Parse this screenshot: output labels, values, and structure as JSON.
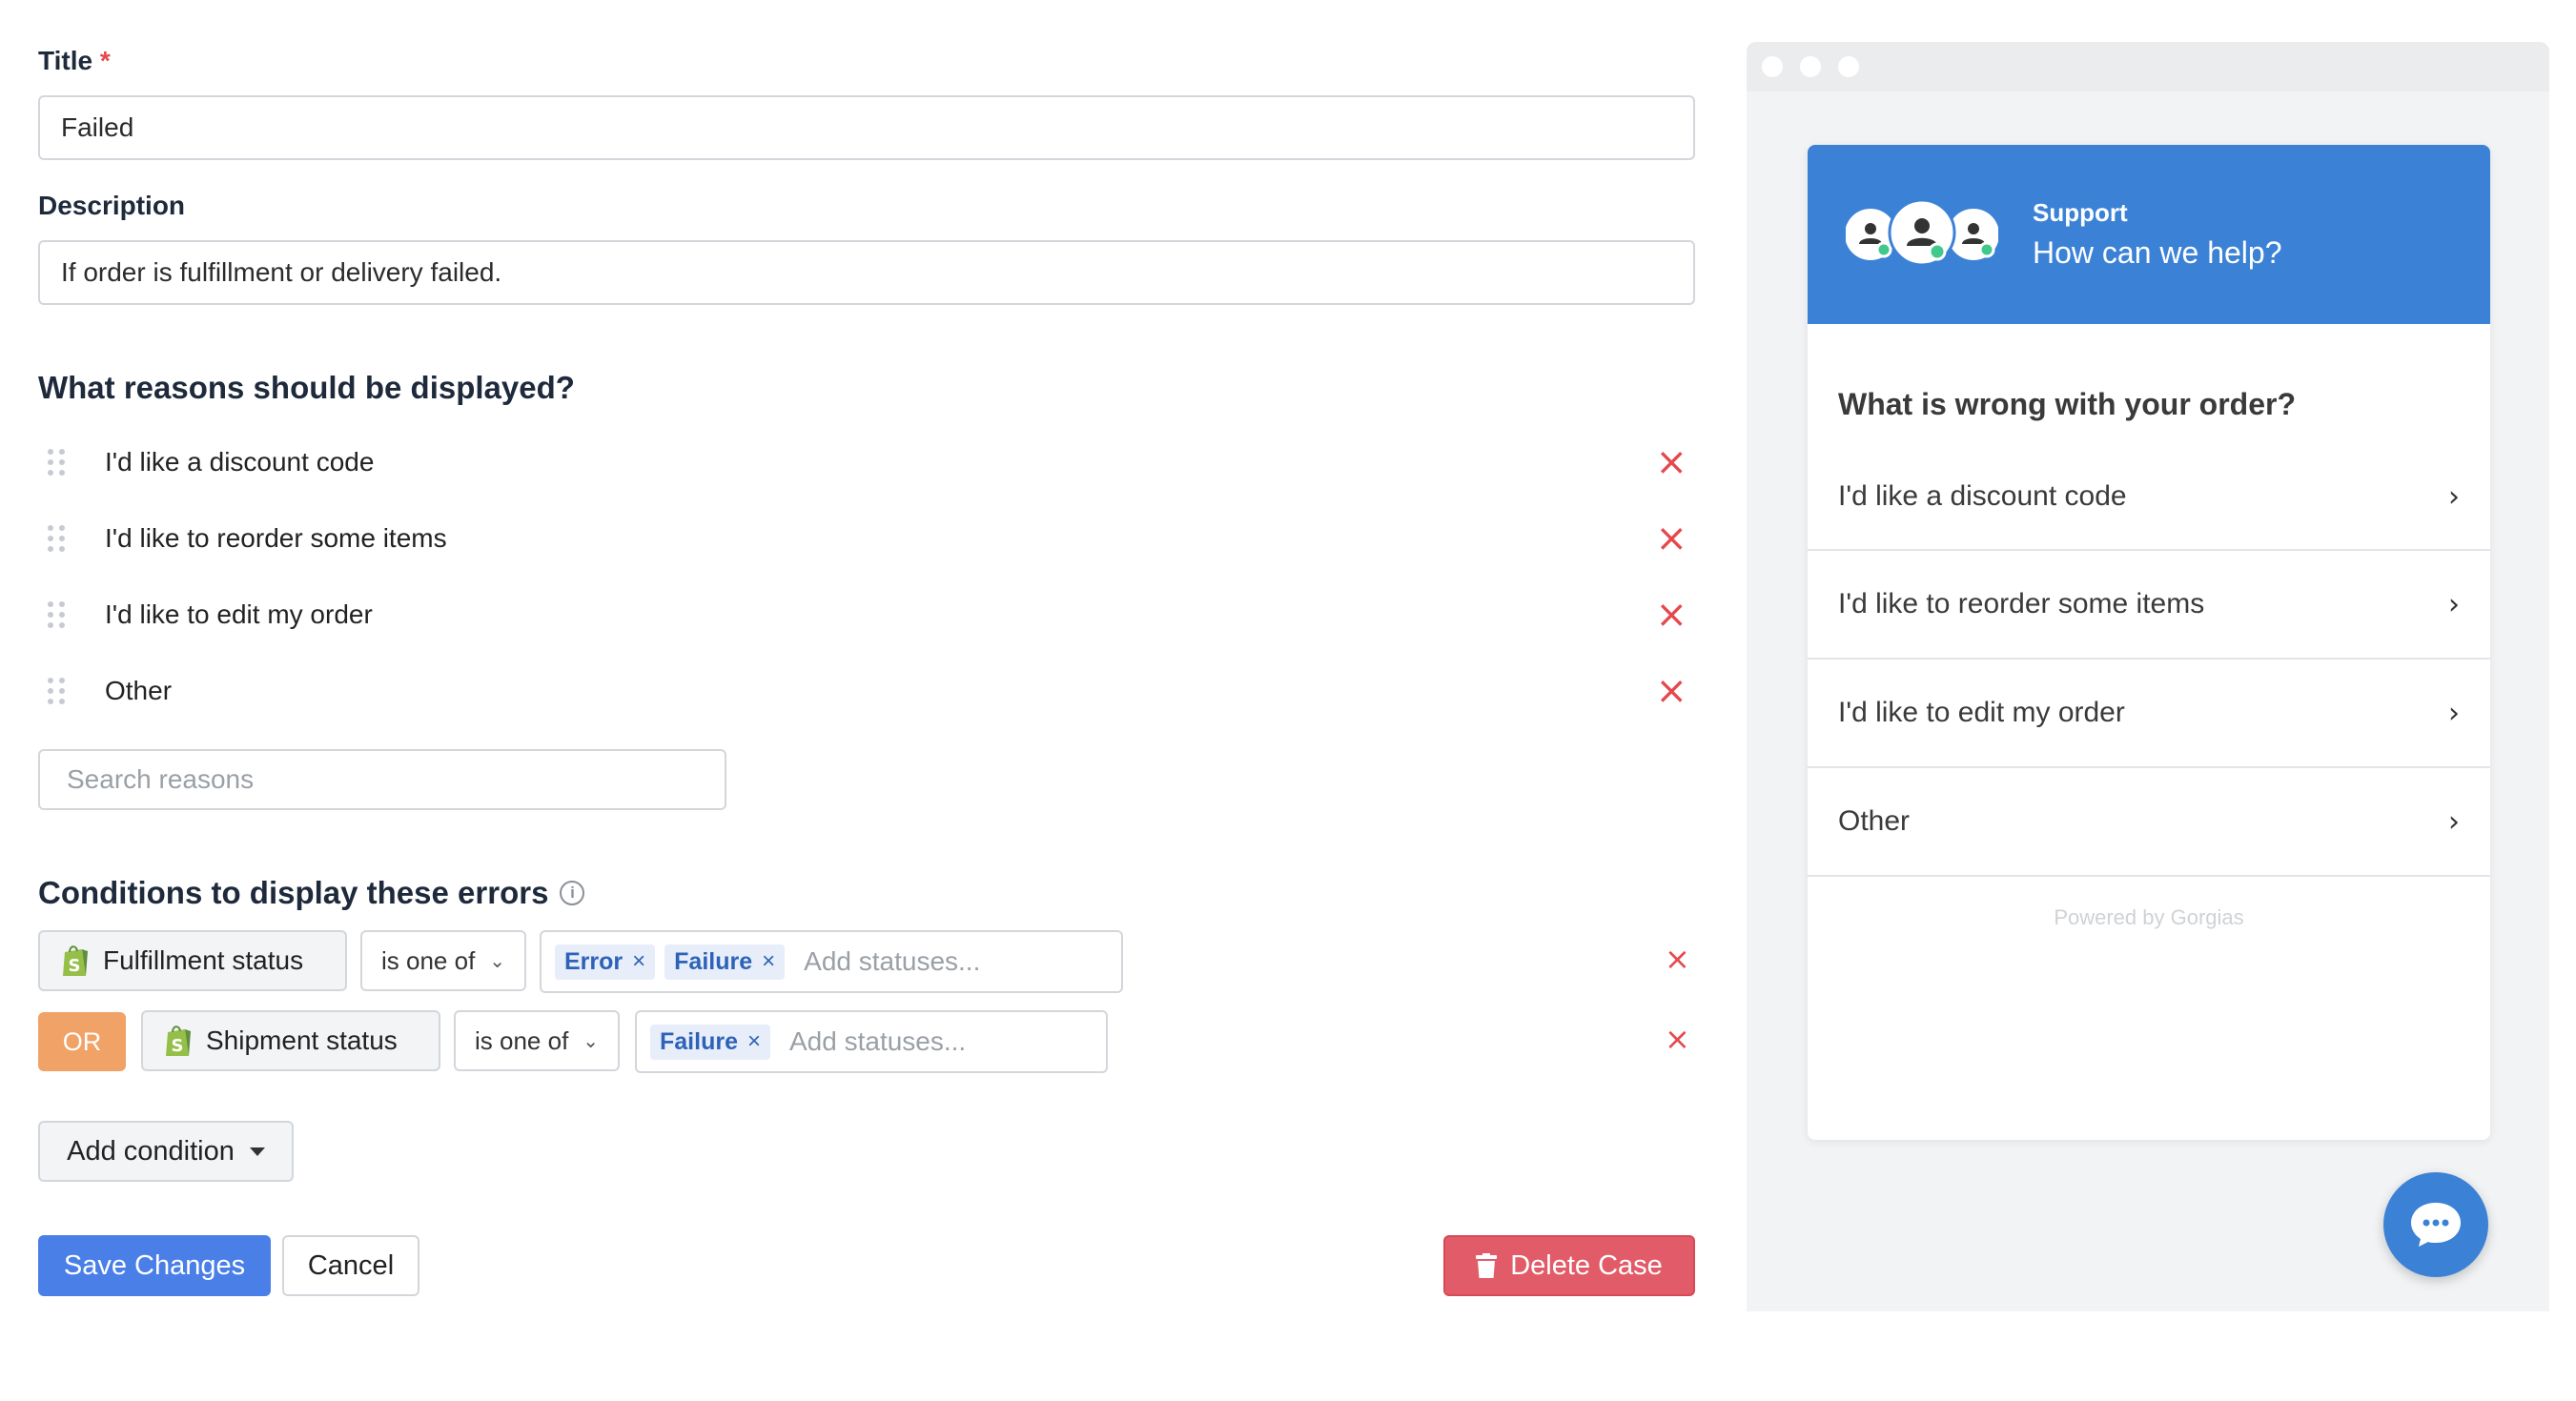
{
  "form": {
    "title_label": "Title",
    "required_mark": "*",
    "title_value": "Failed",
    "description_label": "Description",
    "description_value": "If order is fulfillment or delivery failed."
  },
  "reasons": {
    "heading": "What reasons should be displayed?",
    "items": [
      {
        "label": "I'd like a discount code"
      },
      {
        "label": "I'd like to reorder some items"
      },
      {
        "label": "I'd like to edit my order"
      },
      {
        "label": "Other"
      }
    ],
    "search_placeholder": "Search reasons"
  },
  "conditions": {
    "heading": "Conditions to display these errors",
    "rows": [
      {
        "field": "Fulfillment status",
        "operator": "is one of",
        "tags": [
          "Error",
          "Failure"
        ],
        "placeholder": "Add statuses..."
      },
      {
        "connector": "OR",
        "field": "Shipment status",
        "operator": "is one of",
        "tags": [
          "Failure"
        ],
        "placeholder": "Add statuses..."
      }
    ],
    "add_condition": "Add condition"
  },
  "actions": {
    "save": "Save Changes",
    "cancel": "Cancel",
    "delete": "Delete Case"
  },
  "widget": {
    "header_title": "Support",
    "header_subtitle": "How can we help?",
    "question": "What is wrong with your order?",
    "items": [
      {
        "label": "I'd like a discount code"
      },
      {
        "label": "I'd like to reorder some items"
      },
      {
        "label": "I'd like to edit my order"
      },
      {
        "label": "Other"
      }
    ],
    "powered_by": "Powered by Gorgias"
  },
  "icons": {
    "remove": "×",
    "chevron": "›",
    "dropdown": "⌄"
  },
  "colors": {
    "primary": "#4a7fe8",
    "danger": "#e15c68",
    "or_badge": "#f0a267",
    "widget_header": "#3b82d6",
    "tag_bg": "#e7eef9",
    "tag_text": "#2d62b8"
  }
}
